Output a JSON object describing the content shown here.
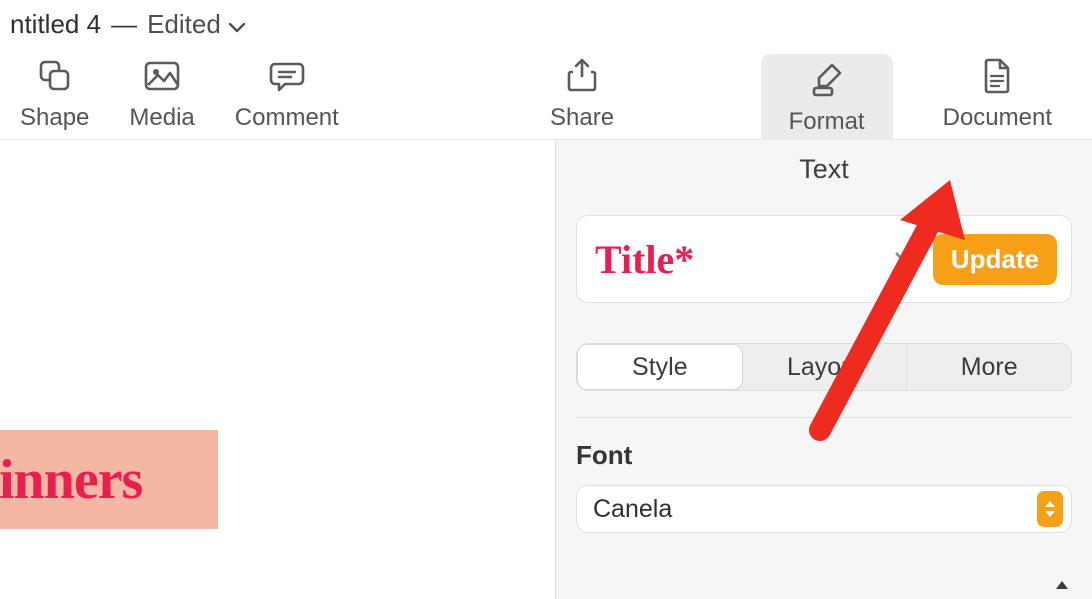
{
  "titlebar": {
    "document_name": "ntitled 4",
    "separator": "—",
    "status": "Edited"
  },
  "toolbar": {
    "shape": "Shape",
    "media": "Media",
    "comment": "Comment",
    "share": "Share",
    "format": "Format",
    "document": "Document"
  },
  "canvas": {
    "selected_text_fragment": "inners"
  },
  "inspector": {
    "header": "Text",
    "style_card": {
      "style_name": "Title*",
      "update_label": "Update"
    },
    "tabs": {
      "style": "Style",
      "layout": "Layout",
      "more": "More"
    },
    "font": {
      "section_label": "Font",
      "current_family": "Canela"
    }
  }
}
